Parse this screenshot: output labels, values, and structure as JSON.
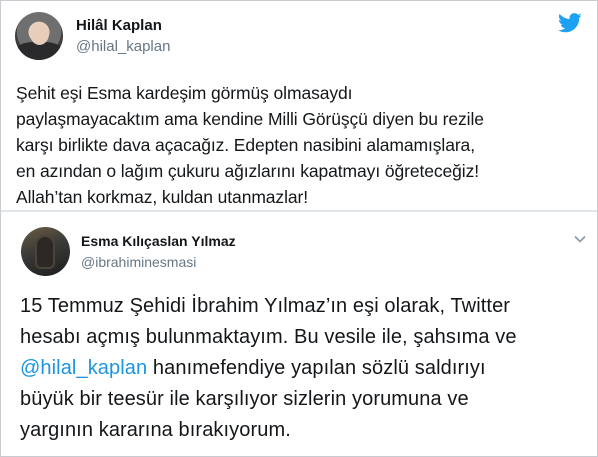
{
  "tweet_1": {
    "author_name": "Hilâl Kaplan",
    "author_handle": "@hilal_kaplan",
    "text_lines": [
      "Şehit eşi Esma kardeşim görmüş olmasaydı",
      "paylaşmayacaktım ama kendine Milli Görüşçü diyen bu rezile",
      "karşı birlikte dava açacağız. Edepten nasibini alamamışlara,",
      "en azından o lağım çukuru ağızlarını kapatmayı öğreteceğiz!",
      "Allah’tan korkmaz, kuldan utanmazlar!"
    ],
    "icon": "twitter-bird-icon",
    "accent_color": "#1da1f2"
  },
  "tweet_2": {
    "author_name": "Esma Kılıçaslan Yılmaz",
    "author_handle": "@ibrahiminesmasi",
    "line_1": "15 Temmuz Şehidi İbrahim Yılmaz’ın eşi olarak, Twitter",
    "line_2": "hesabı açmış bulunmaktayım. Bu vesile ile, şahsıma ve",
    "line_3_mention": "@hilal_kaplan",
    "line_3_rest": " hanımefendiye yapılan sözlü saldırıyı",
    "line_4": "büyük bir teesür ile karşılıyor sizlerin yorumuna ve",
    "line_5": "yargının kararına bırakıyorum.",
    "icon": "chevron-down-icon",
    "mention_color": "#1b95e0"
  }
}
